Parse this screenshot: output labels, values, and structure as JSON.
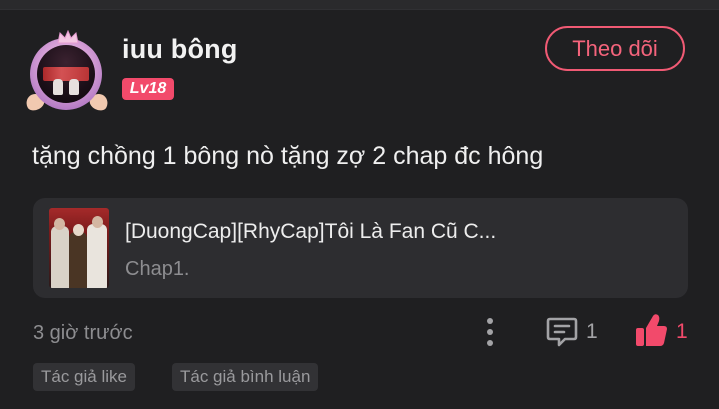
{
  "user": {
    "name": "iuu bông",
    "level": "Lv18",
    "follow_label": "Theo dõi"
  },
  "comment": {
    "text": "tặng chồng 1 bông nò tặng zợ 2 chap đc hông",
    "time": "3 giờ trước",
    "reply_count": "1",
    "like_count": "1"
  },
  "comic": {
    "title": "[DuongCap][RhyCap]Tôi Là Fan Cũ C...",
    "chapter": "Chap1."
  },
  "tags": {
    "author_like": "Tác giả like",
    "author_reply": "Tác giả bình luận"
  },
  "icons": {
    "more": "more-vertical-icon",
    "reply": "comment-icon",
    "like": "thumbs-up-icon"
  },
  "colors": {
    "accent": "#f24a6b",
    "follow_border": "#f05a74",
    "background": "#1f1f21",
    "card": "#2d2d30",
    "muted_text": "#8d8d90"
  }
}
